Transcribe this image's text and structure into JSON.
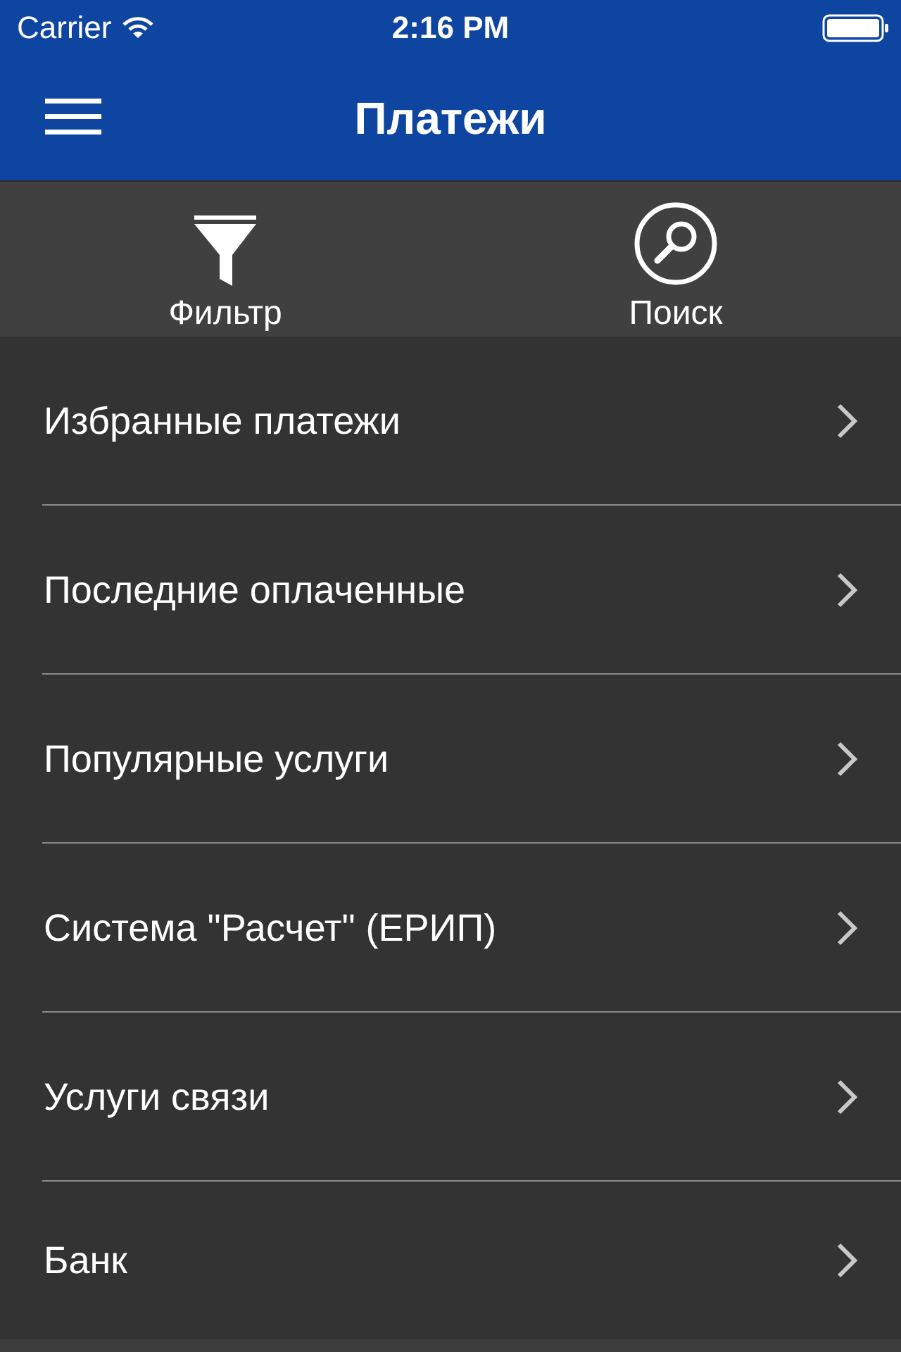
{
  "status_bar": {
    "carrier": "Carrier",
    "time": "2:16 PM"
  },
  "nav": {
    "title": "Платежи"
  },
  "toolbar": [
    {
      "kind": "filter",
      "label": "Фильтр"
    },
    {
      "kind": "search",
      "label": "Поиск"
    }
  ],
  "menu": [
    {
      "label": "Избранные платежи"
    },
    {
      "label": "Последние оплаченные"
    },
    {
      "label": "Популярные услуги"
    },
    {
      "label": "Система \"Расчет\" (ЕРИП)"
    },
    {
      "label": "Услуги связи"
    },
    {
      "label": "Банк"
    }
  ]
}
